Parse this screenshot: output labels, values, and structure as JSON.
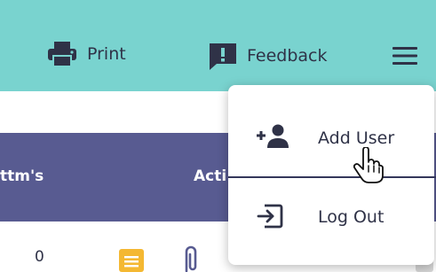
{
  "toolbar": {
    "print_label": "Print",
    "print_icon": "printer-icon",
    "feedback_label": "Feedback",
    "feedback_icon": "feedback-icon",
    "menu_icon": "hamburger-menu-icon"
  },
  "table": {
    "headers": [
      "ttm's",
      "Acti"
    ],
    "rows": [
      {
        "count": "0"
      }
    ]
  },
  "menu": {
    "items": [
      {
        "label": "Add User",
        "icon": "add-user-icon"
      },
      {
        "label": "Log Out",
        "icon": "log-out-icon"
      }
    ]
  },
  "colors": {
    "topbar": "#79d3cf",
    "table_header": "#585b91",
    "text_dark": "#2f3247",
    "note_icon": "#f4b832"
  }
}
